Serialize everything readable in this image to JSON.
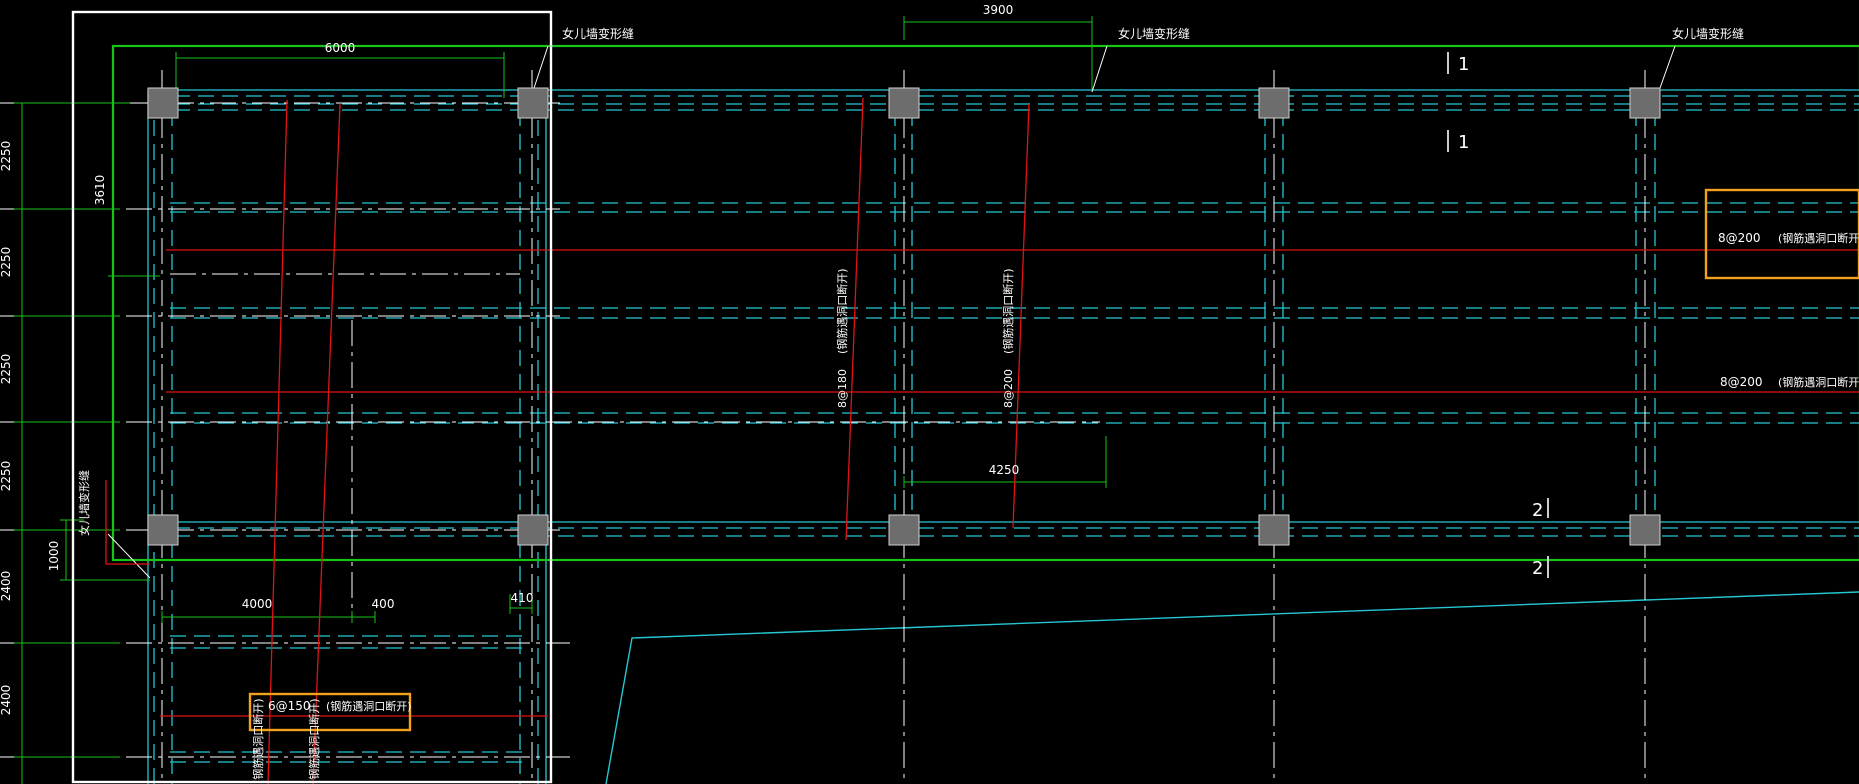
{
  "colors": {
    "background": "#000000",
    "grid": "#ffffff",
    "beam": "#26c7d4",
    "rebar": "#e01414",
    "dimension": "#19c419",
    "highlight": "#f0a21c",
    "column": "#6d6d6d"
  },
  "dims": {
    "top_6000": "6000",
    "top_3900": "3900",
    "left_3610": "3610",
    "mid_4250": "4250",
    "low_4000": "4000",
    "low_400": "400",
    "low_410": "410",
    "left_1000": "1000",
    "axis": [
      "2250",
      "2250",
      "2250",
      "2250",
      "2400",
      "2400"
    ]
  },
  "notes": {
    "parapet_joint": "女儿墙变形缝",
    "rebar_8_200": "8@200",
    "rebar_8_180": "8@180",
    "rebar_6_150": "6@150",
    "opening_cut": "(钢筋遇洞口断开)"
  },
  "sections": {
    "s1": "1",
    "s2": "2"
  }
}
